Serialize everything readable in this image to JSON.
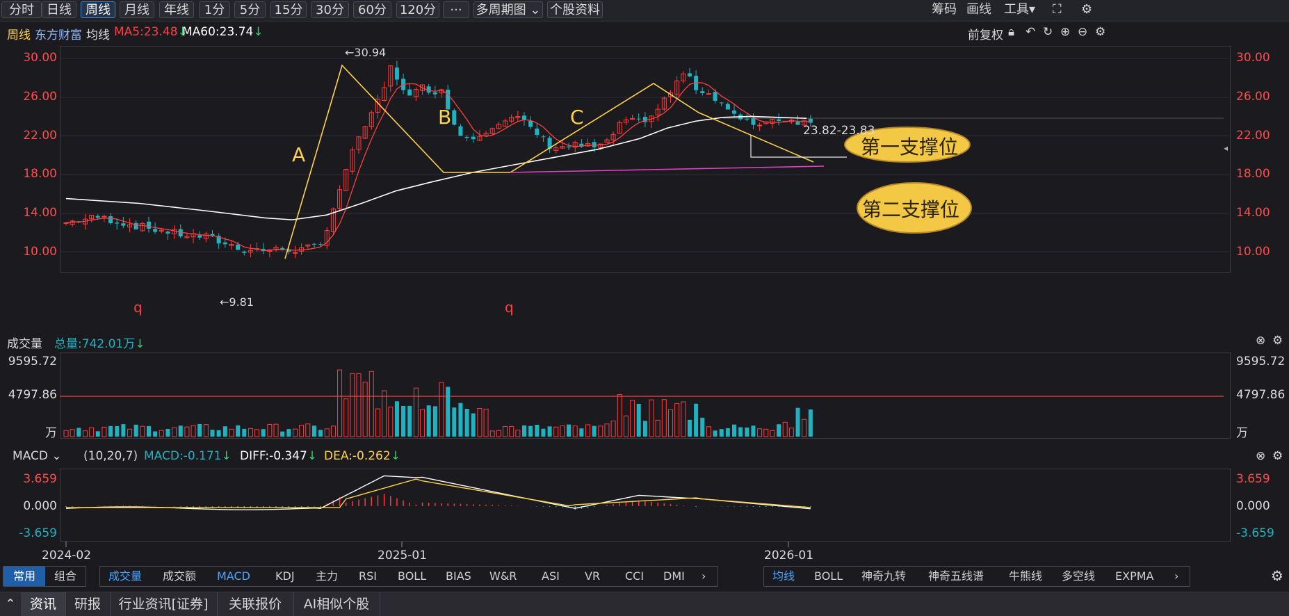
{
  "toolbar": {
    "buttons": [
      "分时",
      "日线",
      "周线",
      "月线",
      "年线",
      "1分",
      "5分",
      "15分",
      "30分",
      "60分",
      "120分",
      "···",
      "多周期图",
      "个股资料"
    ],
    "active": "周线",
    "right": [
      "筹码",
      "画线",
      "工具"
    ]
  },
  "info": {
    "period": "周线",
    "name": "东方财富",
    "ma_label": "均线",
    "ma5": "MA5:23.48",
    "ma60": "MA60:23.74",
    "fuquan": "前复权"
  },
  "price_axis": [
    "30.00",
    "26.00",
    "22.00",
    "18.00",
    "14.00",
    "10.00"
  ],
  "annotations": {
    "high": "←30.94",
    "low": "←9.81",
    "range": "23.82-23.83",
    "wave_a": "A",
    "wave_b": "B",
    "wave_c": "C",
    "q1": "q",
    "q2": "q",
    "support1": "第一支撑位",
    "support2": "第二支撑位"
  },
  "volume": {
    "title": "成交量",
    "total": "总量:742.01万",
    "axis": [
      "9595.72",
      "4797.86",
      "万"
    ]
  },
  "macd": {
    "title": "MACD",
    "params": "(10,20,7)",
    "macd": "MACD:-0.171",
    "diff": "DIFF:-0.347",
    "dea": "DEA:-0.262",
    "axis": [
      "3.659",
      "0.000",
      "-3.659"
    ]
  },
  "dates": [
    "2024-02",
    "2025-01",
    "2026-01"
  ],
  "indicator_tabs": {
    "group": [
      "常用",
      "组合"
    ],
    "tabs": [
      "成交量",
      "成交额",
      "MACD",
      "KDJ",
      "主力",
      "RSI",
      "BOLL",
      "BIAS",
      "W&R",
      "ASI",
      "VR",
      "CCI",
      "DMI"
    ]
  },
  "overlay_tabs": [
    "均线",
    "BOLL",
    "神奇九转",
    "神奇五线谱",
    "牛熊线",
    "多空线",
    "EXPMA"
  ],
  "news_tabs": [
    "资讯",
    "研报",
    "行业资讯[证券]",
    "关联报价",
    "AI相似个股"
  ],
  "colors": {
    "up": "#ff3b3b",
    "down": "#1fb3c1",
    "ma5": "#ff4040",
    "ma60": "#ffffff",
    "accent": "#ffd24a",
    "pink": "#e040c0"
  }
}
